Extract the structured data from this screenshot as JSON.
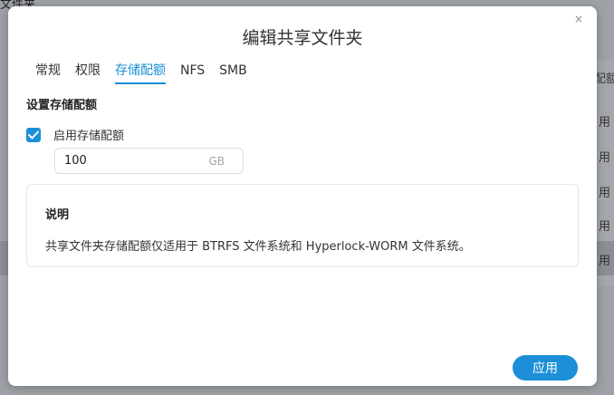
{
  "background": {
    "title_fragment": "文件夹",
    "column_fragment": "配额",
    "row_fragments": [
      "用",
      "用",
      "用",
      "用",
      "用"
    ]
  },
  "dialog": {
    "title": "编辑共享文件夹",
    "close_icon": "×",
    "tabs": [
      {
        "label": "常规",
        "active": false
      },
      {
        "label": "权限",
        "active": false
      },
      {
        "label": "存储配额",
        "active": true
      },
      {
        "label": "NFS",
        "active": false
      },
      {
        "label": "SMB",
        "active": false
      }
    ],
    "section_title": "设置存储配额",
    "enable_quota": {
      "label": "启用存储配额",
      "checked": true
    },
    "quota": {
      "value": "100",
      "unit": "GB"
    },
    "info": {
      "title": "说明",
      "text": "共享文件夹存储配额仅适用于 BTRFS 文件系统和 Hyperlock-WORM 文件系统。"
    },
    "apply_label": "应用"
  },
  "colors": {
    "accent": "#1c8fd8",
    "overlay": "#9ea1a6"
  }
}
